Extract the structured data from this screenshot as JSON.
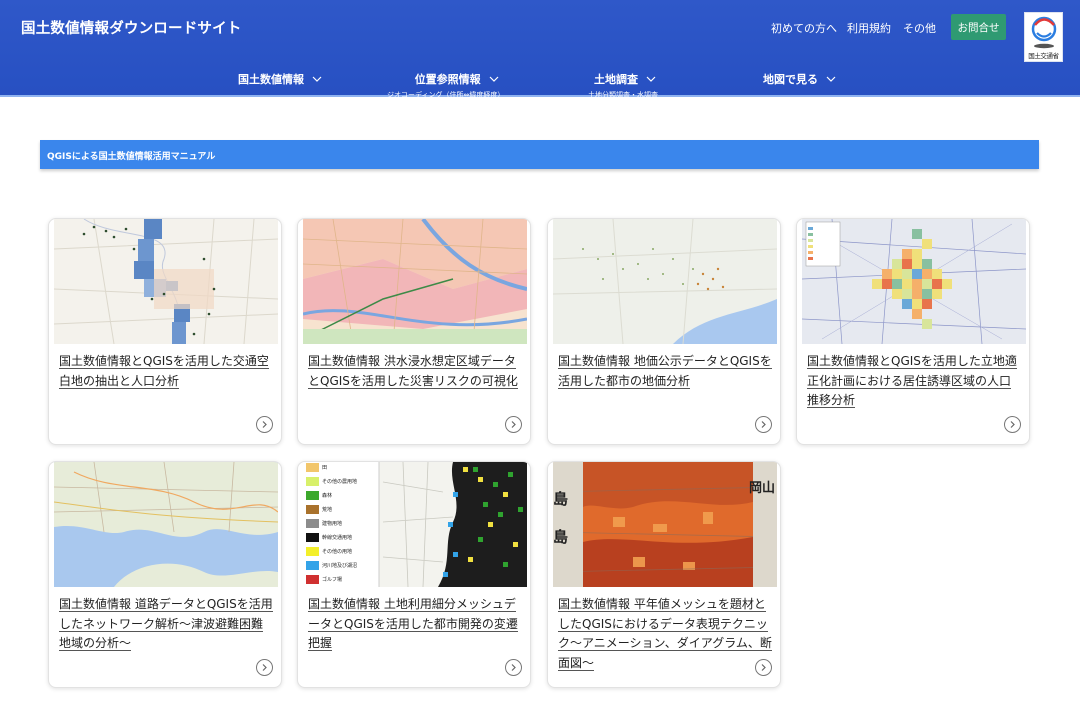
{
  "header": {
    "site_title": "国土数値情報ダウンロードサイト",
    "top_links": [
      "初めての方へ",
      "利用規約",
      "その他"
    ],
    "contact_label": "お問合せ",
    "logo_text": "国土交通省",
    "colors": {
      "header_bg": "#2b52c4",
      "contact_bg": "#2f9a72",
      "section_bar": "#3a86ec"
    }
  },
  "nav": [
    {
      "label": "国土数値情報",
      "sub": ""
    },
    {
      "label": "位置参照情報",
      "sub": "ジオコーディング（住所⇔緯度経度）"
    },
    {
      "label": "土地調査",
      "sub": "土地分類調査・水調査"
    },
    {
      "label": "地図で見る",
      "sub": ""
    }
  ],
  "section": {
    "title": "QGISによる国土数値情報活用マニュアル"
  },
  "cards": [
    {
      "title": "国土数値情報とQGISを活用した交通空白地の抽出と人口分析",
      "icon": "chevron-right-circle-icon"
    },
    {
      "title": "国土数値情報 洪水浸水想定区域データとQGISを活用した災害リスクの可視化",
      "icon": "chevron-right-circle-icon"
    },
    {
      "title": "国土数値情報 地価公示データとQGISを活用した都市の地価分析",
      "icon": "chevron-right-circle-icon"
    },
    {
      "title": "国土数値情報とQGISを活用した立地適正化計画における居住誘導区域の人口推移分析",
      "icon": "chevron-right-circle-icon"
    },
    {
      "title": "国土数値情報 道路データとQGISを活用したネットワーク解析〜津波避難困難地域の分析〜",
      "icon": "chevron-right-circle-icon"
    },
    {
      "title": "国土数値情報 土地利用細分メッシュデータとQGISを活用した都市開発の変遷把握",
      "icon": "chevron-right-circle-icon"
    },
    {
      "title": "国土数値情報 平年値メッシュを題材としたQGISにおけるデータ表現テクニック〜アニメーション、ダイアグラム、断面図〜",
      "icon": "chevron-right-circle-icon"
    }
  ],
  "thumb6_legend": [
    "田",
    "その他の農用地",
    "森林",
    "荒地",
    "建物用地",
    "幹線交通用地",
    "その他の用地",
    "河川地及び湖沼",
    "ゴルフ場"
  ],
  "thumb6_legend_colors": [
    "#f2c66b",
    "#d8f06a",
    "#3ca82c",
    "#a9722c",
    "#8c8c8c",
    "#111111",
    "#f3ef2a",
    "#33a3e8",
    "#d03030"
  ],
  "thumb7_labels": [
    "島",
    "島",
    "岡山"
  ]
}
